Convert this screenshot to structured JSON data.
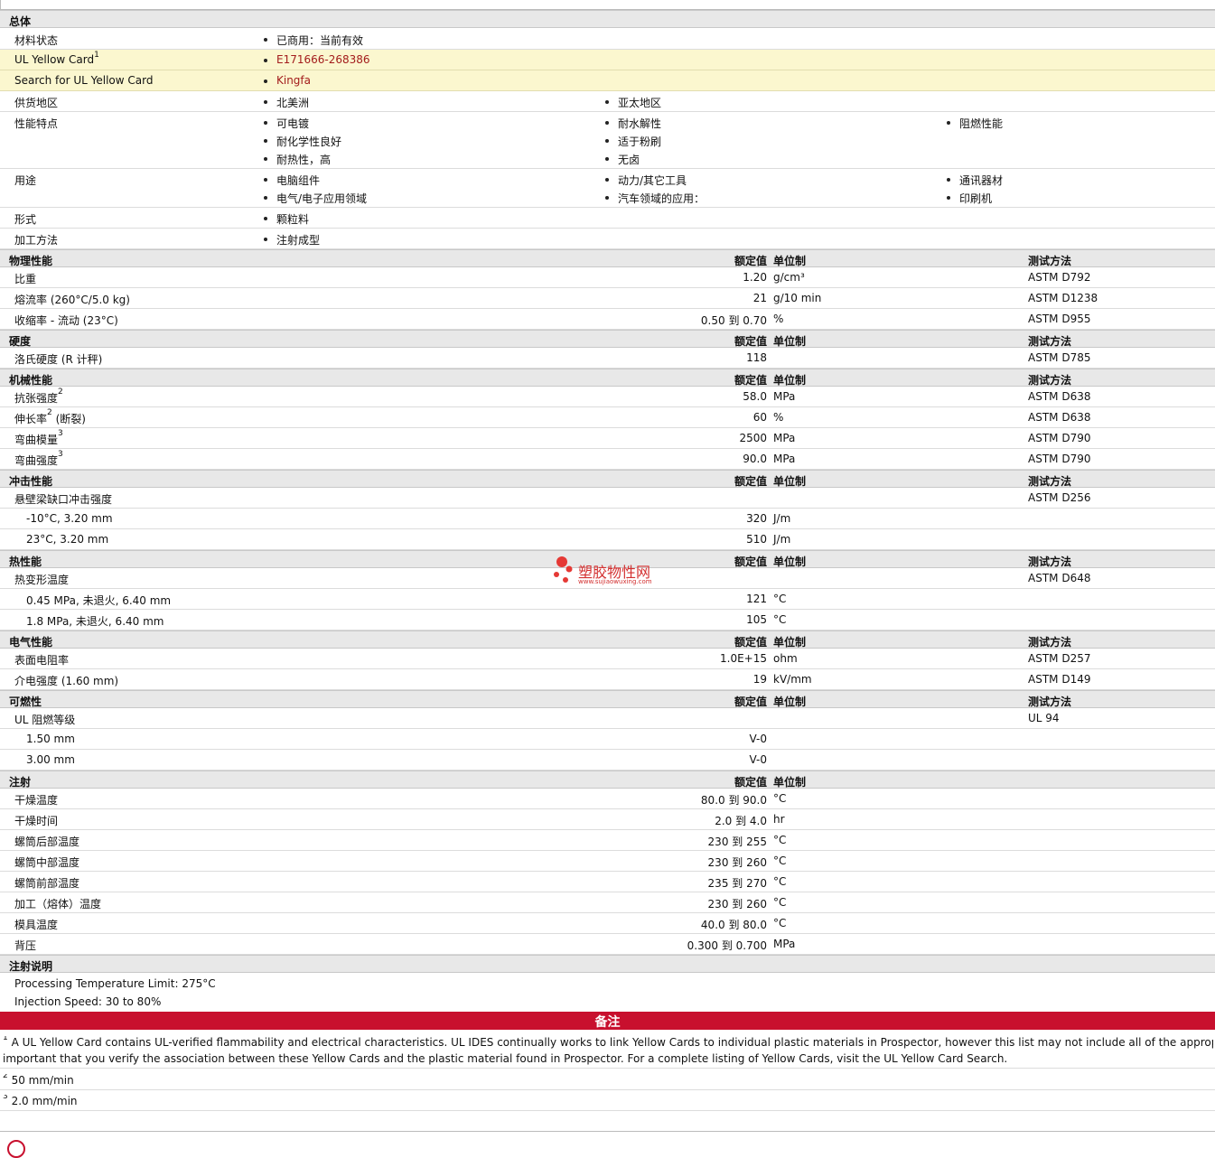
{
  "general": {
    "title": "总体",
    "rows": [
      {
        "label": "材料状态",
        "values": [
          "已商用：当前有效"
        ]
      },
      {
        "label": "UL Yellow Card",
        "sup": "1",
        "values": [
          "E171666-268386"
        ]
      },
      {
        "label": "Search for UL Yellow Card",
        "values": [
          "Kingfa"
        ]
      },
      {
        "label": "供货地区",
        "col1": [
          "北美洲"
        ],
        "col2": [
          "亚太地区"
        ]
      },
      {
        "label": "性能特点",
        "col1": [
          "可电镀",
          "耐化学性良好",
          "耐热性，高"
        ],
        "col2": [
          "耐水解性",
          "适于粉刷",
          "无卤"
        ],
        "col3": [
          "阻燃性能"
        ]
      },
      {
        "label": "用途",
        "col1": [
          "电脑组件",
          "电气/电子应用领域"
        ],
        "col2": [
          "动力/其它工具",
          "汽车领域的应用："
        ],
        "col3": [
          "通讯器材",
          "印刷机"
        ]
      },
      {
        "label": "形式",
        "col1": [
          "颗粒料"
        ]
      },
      {
        "label": "加工方法",
        "col1": [
          "注射成型"
        ]
      }
    ]
  },
  "headers": {
    "value": "额定值",
    "unit": "单位制",
    "test": "测试方法"
  },
  "physical": {
    "title": "物理性能",
    "rows": [
      {
        "label": "比重",
        "value": "1.20",
        "unit": "g/cm³",
        "test": "ASTM D792"
      },
      {
        "label": "熔流率  (260°C/5.0 kg)",
        "value": "21",
        "unit": "g/10 min",
        "test": "ASTM D1238"
      },
      {
        "label": "收缩率  - 流动  (23°C)",
        "value": "0.50  到   0.70",
        "unit": "%",
        "test": "ASTM D955"
      }
    ]
  },
  "hardness": {
    "title": "硬度",
    "rows": [
      {
        "label": "洛氏硬度  (R 计秤)",
        "value": "118",
        "unit": "",
        "test": "ASTM D785"
      }
    ]
  },
  "mechanical": {
    "title": "机械性能",
    "rows": [
      {
        "label": "抗张强度",
        "sup": "2",
        "value": "58.0",
        "unit": "MPa",
        "test": "ASTM D638"
      },
      {
        "label": "伸长率",
        "sup": "2",
        "suffix": " (断裂)",
        "value": "60",
        "unit": "%",
        "test": "ASTM D638"
      },
      {
        "label": "弯曲模量",
        "sup": "3",
        "value": "2500",
        "unit": "MPa",
        "test": "ASTM D790"
      },
      {
        "label": "弯曲强度",
        "sup": "3",
        "value": "90.0",
        "unit": "MPa",
        "test": "ASTM D790"
      }
    ]
  },
  "impact": {
    "title": "冲击性能",
    "rows": [
      {
        "label": "悬壁梁缺口冲击强度",
        "value": "",
        "unit": "",
        "test": "ASTM D256"
      },
      {
        "label": "-10°C, 3.20 mm",
        "value": "320",
        "unit": "J/m",
        "test": "",
        "indent": true
      },
      {
        "label": "23°C, 3.20 mm",
        "value": "510",
        "unit": "J/m",
        "test": "",
        "indent": true
      }
    ]
  },
  "thermal": {
    "title": "热性能",
    "rows": [
      {
        "label": "热变形温度",
        "value": "",
        "unit": "",
        "test": "ASTM D648"
      },
      {
        "label": "0.45 MPa, 未退火, 6.40 mm",
        "value": "121",
        "unit": "°C",
        "test": "",
        "indent": true
      },
      {
        "label": "1.8 MPa, 未退火, 6.40 mm",
        "value": "105",
        "unit": "°C",
        "test": "",
        "indent": true
      }
    ]
  },
  "electrical": {
    "title": "电气性能",
    "rows": [
      {
        "label": "表面电阻率",
        "value": "1.0E+15",
        "unit": "ohm",
        "test": "ASTM D257"
      },
      {
        "label": "介电强度  (1.60 mm)",
        "value": "19",
        "unit": "kV/mm",
        "test": "ASTM D149"
      }
    ]
  },
  "flammability": {
    "title": "可燃性",
    "rows": [
      {
        "label": "UL 阻燃等级",
        "value": "",
        "unit": "",
        "test": "UL 94"
      },
      {
        "label": "1.50 mm",
        "value": "V-0",
        "unit": "",
        "test": "",
        "indent": true
      },
      {
        "label": "3.00 mm",
        "value": "V-0",
        "unit": "",
        "test": "",
        "indent": true
      }
    ]
  },
  "injection": {
    "title": "注射",
    "rows": [
      {
        "label": "干燥温度",
        "value": "80.0  到   90.0",
        "unit": "°C"
      },
      {
        "label": "干燥时间",
        "value": "2.0  到   4.0",
        "unit": "hr"
      },
      {
        "label": "螺筒后部温度",
        "value": "230  到   255",
        "unit": "°C"
      },
      {
        "label": "螺筒中部温度",
        "value": "230  到   260",
        "unit": "°C"
      },
      {
        "label": "螺筒前部温度",
        "value": "235  到   270",
        "unit": "°C"
      },
      {
        "label": "加工（熔体）温度",
        "value": "230  到   260",
        "unit": "°C"
      },
      {
        "label": "模具温度",
        "value": "40.0  到   80.0",
        "unit": "°C"
      },
      {
        "label": "背压",
        "value": "0.300  到   0.700",
        "unit": "MPa"
      }
    ]
  },
  "injection_notes": {
    "title": "注射说明",
    "lines": [
      "Processing Temperature Limit: 275°C",
      "Injection Speed: 30 to 80%"
    ]
  },
  "notes": {
    "title": "备注",
    "items": [
      {
        "sup": "1",
        "text": "A UL Yellow Card contains UL-verified flammability and electrical characteristics. UL IDES continually works to link Yellow Cards to individual plastic materials in Prospector, however this list may not include all of the appropriate li"
      },
      {
        "sup": "",
        "text": "important that you verify the association between these Yellow Cards and the plastic material found in Prospector. For a complete listing of Yellow Cards, visit the UL Yellow Card Search."
      },
      {
        "sup": "2",
        "text": "50 mm/min"
      },
      {
        "sup": "3",
        "text": "2.0 mm/min"
      }
    ]
  },
  "watermark": {
    "text": "塑胶物性网",
    "sub": "www.sujiaowuxing.com"
  },
  "colors": {
    "accent": "#c8102e",
    "highlight": "#fbf7cf",
    "header_bg": "#e8e8e8",
    "link": "#a31c1c"
  }
}
